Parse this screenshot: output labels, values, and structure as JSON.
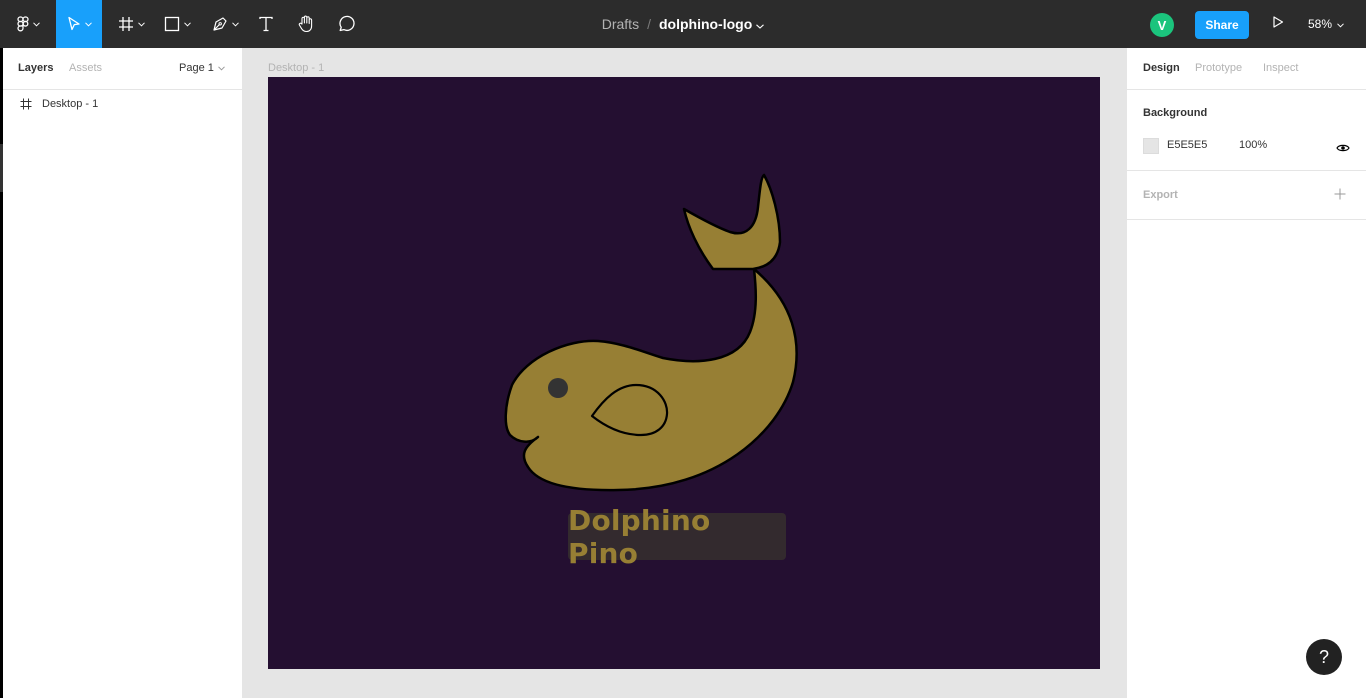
{
  "toolbar": {
    "tools": [
      {
        "name": "main-menu",
        "icon": "figma-logo-icon"
      },
      {
        "name": "move-tool",
        "icon": "cursor-arrow-icon",
        "active": true
      },
      {
        "name": "frame-tool",
        "icon": "frame-hash-icon"
      },
      {
        "name": "shape-tool",
        "icon": "rectangle-icon"
      },
      {
        "name": "pen-tool",
        "icon": "pen-nib-icon"
      },
      {
        "name": "text-tool",
        "icon": "text-t-icon"
      },
      {
        "name": "hand-tool",
        "icon": "hand-icon"
      },
      {
        "name": "comment-tool",
        "icon": "speech-bubble-icon"
      }
    ],
    "breadcrumb_root": "Drafts",
    "breadcrumb_sep": "/",
    "file_name": "dolphino-logo",
    "avatar_initial": "V",
    "share_label": "Share",
    "zoom": "58%"
  },
  "left_panel": {
    "tab_layers": "Layers",
    "tab_assets": "Assets",
    "page_selector": "Page 1",
    "layers": [
      {
        "label": "Desktop - 1",
        "icon": "frame-hash-icon"
      }
    ]
  },
  "canvas": {
    "frame_label": "Desktop - 1",
    "frame_color": "#240f31",
    "logo_text": "Dolphino Pino",
    "logo_color": "#977f34"
  },
  "right_panel": {
    "tab_design": "Design",
    "tab_prototype": "Prototype",
    "tab_inspect": "Inspect",
    "background_title": "Background",
    "background_hex": "E5E5E5",
    "background_opacity": "100%",
    "export_title": "Export"
  },
  "help_label": "?",
  "colors": {
    "toolbar_bg": "#2c2c2c",
    "accent": "#18a0fb",
    "avatar": "#1bc47d",
    "canvas_bg": "#e5e5e5"
  }
}
